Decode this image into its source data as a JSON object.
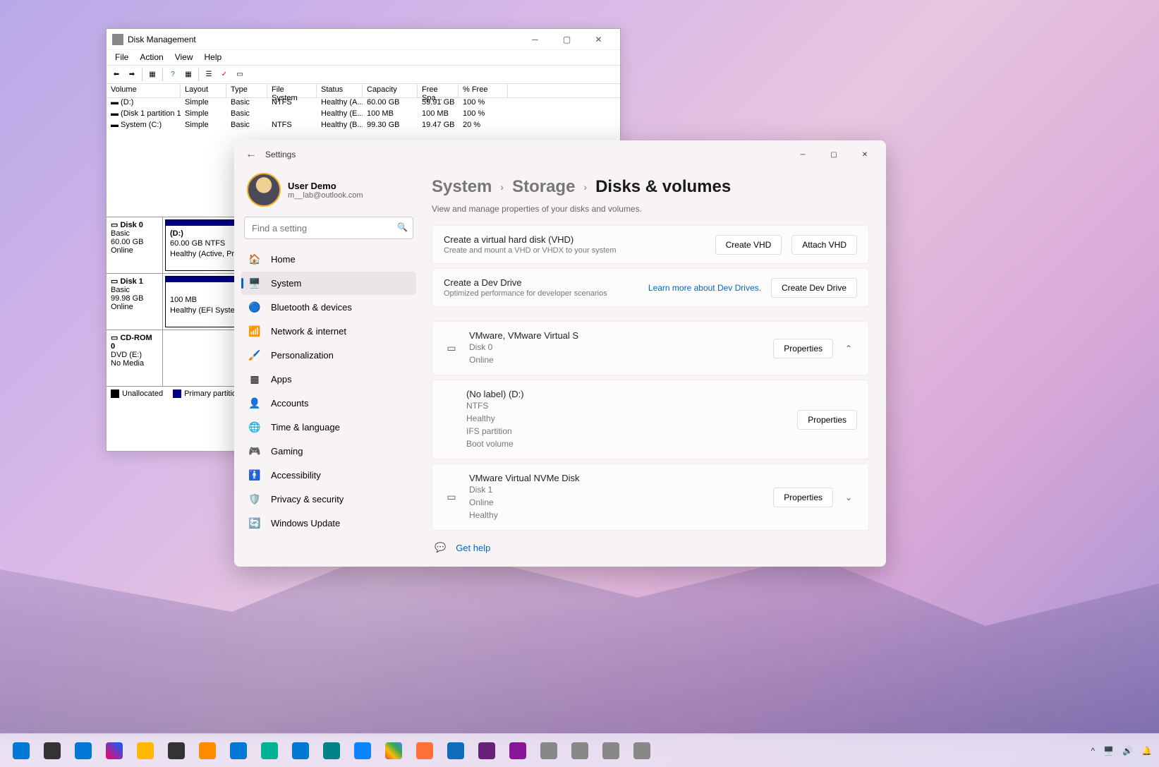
{
  "dm": {
    "title": "Disk Management",
    "menus": [
      "File",
      "Action",
      "View",
      "Help"
    ],
    "toolbar_icons": [
      "back-arrow-icon",
      "forward-arrow-icon",
      "sep",
      "table-icon",
      "sep",
      "help-icon",
      "refresh-icon",
      "sep",
      "list-icon",
      "check-icon",
      "detail-icon"
    ],
    "cols": [
      "Volume",
      "Layout",
      "Type",
      "File System",
      "Status",
      "Capacity",
      "Free Spa...",
      "% Free"
    ],
    "rows": [
      {
        "vol": "(D:)",
        "lay": "Simple",
        "typ": "Basic",
        "fs": "NTFS",
        "st": "Healthy (A...",
        "cap": "60.00 GB",
        "fr": "59.91 GB",
        "pf": "100 %"
      },
      {
        "vol": "(Disk 1 partition 1)",
        "lay": "Simple",
        "typ": "Basic",
        "fs": "",
        "st": "Healthy (E...",
        "cap": "100 MB",
        "fr": "100 MB",
        "pf": "100 %"
      },
      {
        "vol": "System (C:)",
        "lay": "Simple",
        "typ": "Basic",
        "fs": "NTFS",
        "st": "Healthy (B...",
        "cap": "99.30 GB",
        "fr": "19.47 GB",
        "pf": "20 %"
      }
    ],
    "disks": [
      {
        "name": "Disk 0",
        "type": "Basic",
        "size": "60.00 GB",
        "state": "Online",
        "part": {
          "label": "(D:)",
          "detail": "60.00 GB NTFS",
          "status": "Healthy (Active, Prim"
        }
      },
      {
        "name": "Disk 1",
        "type": "Basic",
        "size": "99.98 GB",
        "state": "Online",
        "part": {
          "label": "",
          "detail": "100 MB",
          "status": "Healthy (EFI System F"
        }
      },
      {
        "name": "CD-ROM 0",
        "type": "DVD (E:)",
        "size": "",
        "state": "No Media",
        "part": null
      }
    ],
    "legend": {
      "unalloc": "Unallocated",
      "primary": "Primary partition"
    }
  },
  "settings": {
    "title": "Settings",
    "user": {
      "name": "User Demo",
      "email": "m__lab@outlook.com"
    },
    "search_placeholder": "Find a setting",
    "nav": [
      {
        "icon": "🏠",
        "label": "Home"
      },
      {
        "icon": "🖥️",
        "label": "System"
      },
      {
        "icon": "🔵",
        "label": "Bluetooth & devices"
      },
      {
        "icon": "📶",
        "label": "Network & internet"
      },
      {
        "icon": "🖌️",
        "label": "Personalization"
      },
      {
        "icon": "▦",
        "label": "Apps"
      },
      {
        "icon": "👤",
        "label": "Accounts"
      },
      {
        "icon": "🌐",
        "label": "Time & language"
      },
      {
        "icon": "🎮",
        "label": "Gaming"
      },
      {
        "icon": "🚹",
        "label": "Accessibility"
      },
      {
        "icon": "🛡️",
        "label": "Privacy & security"
      },
      {
        "icon": "🔄",
        "label": "Windows Update"
      }
    ],
    "crumbs": [
      "System",
      "Storage",
      "Disks & volumes"
    ],
    "subtitle": "View and manage properties of your disks and volumes.",
    "vhd": {
      "title": "Create a virtual hard disk (VHD)",
      "sub": "Create and mount a VHD or VHDX to your system",
      "btn_create": "Create VHD",
      "btn_attach": "Attach VHD"
    },
    "dev": {
      "title": "Create a Dev Drive",
      "sub": "Optimized performance for developer scenarios",
      "link": "Learn more about Dev Drives.",
      "btn": "Create Dev Drive"
    },
    "disks": [
      {
        "name": "VMware, VMware Virtual S",
        "l1": "Disk 0",
        "l2": "Online",
        "expanded": true,
        "vol": {
          "name": "(No label) (D:)",
          "lines": [
            "NTFS",
            "Healthy",
            "IFS partition",
            "Boot volume"
          ]
        }
      },
      {
        "name": "VMware Virtual NVMe Disk",
        "l1": "Disk 1",
        "l2": "Online",
        "l3": "Healthy",
        "expanded": false
      }
    ],
    "properties": "Properties",
    "help": "Get help"
  },
  "taskbar": {
    "icons": [
      "start",
      "search",
      "settings",
      "copilot",
      "explorer",
      "terminal",
      "edit",
      "edge",
      "edge-can",
      "edge-beta",
      "edge-dev",
      "firefox-dev",
      "chrome",
      "firefox",
      "mail",
      "dev",
      "pre",
      "app1",
      "app2",
      "app3",
      "app4"
    ],
    "tray": [
      "^",
      "🖥️",
      "🔊",
      "🔔"
    ]
  }
}
